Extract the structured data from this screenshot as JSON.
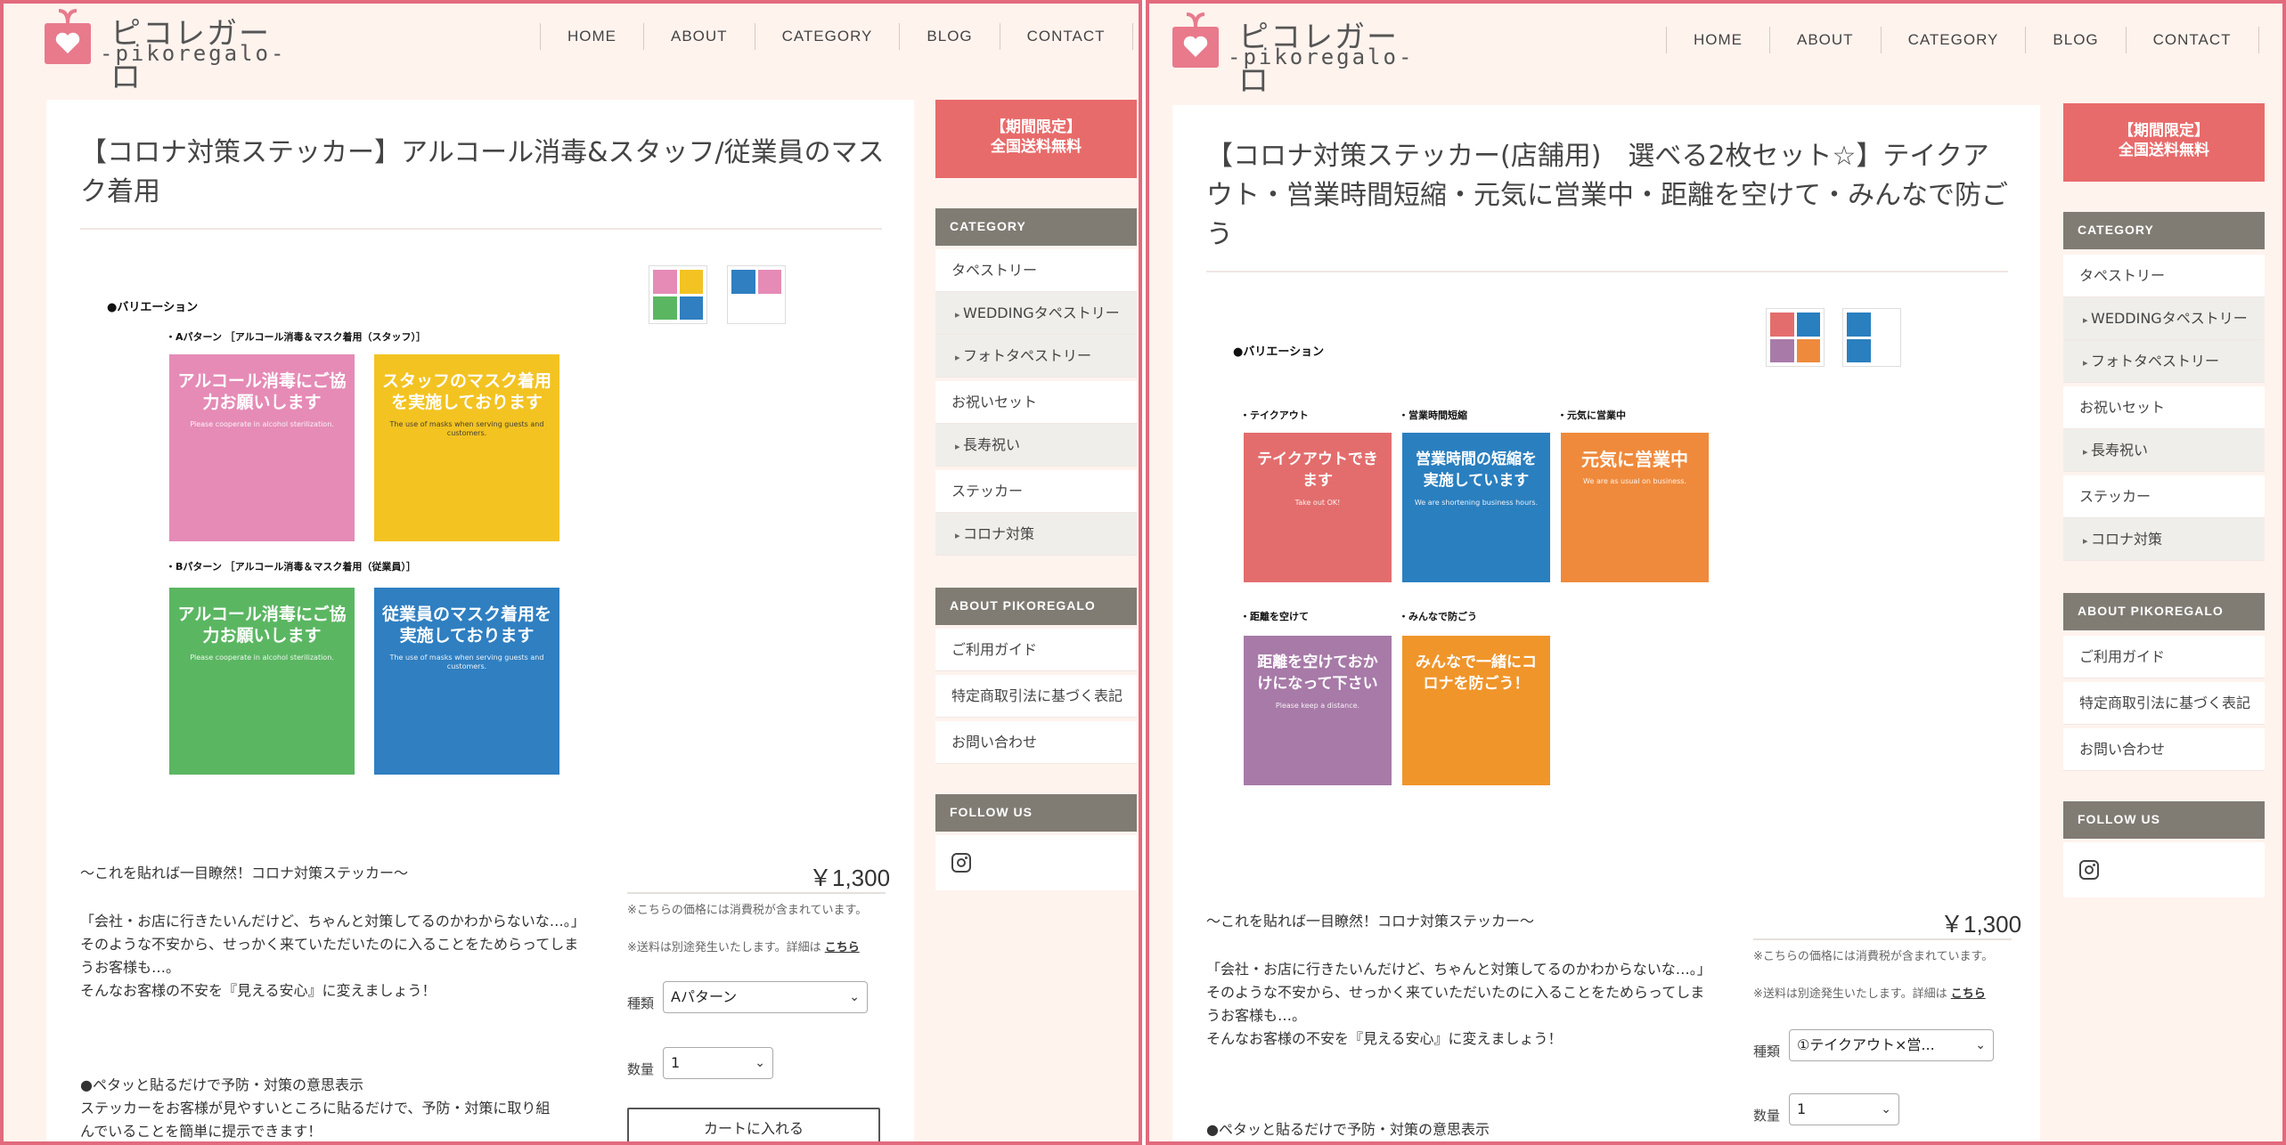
{
  "colors": {
    "page_bg": "#fff3ee",
    "frame": "#e26a7d",
    "banner": "#e86b6b",
    "side_head": "#807c74"
  },
  "header": {
    "logo_jp": "ピコレガーロ",
    "logo_en": "-pikoregalo-",
    "nav": [
      "HOME",
      "ABOUT",
      "CATEGORY",
      "BLOG",
      "CONTACT"
    ]
  },
  "sidebar": {
    "banner_line1": "【期間限定】",
    "banner_line2": "全国送料無料",
    "category_title": "CATEGORY",
    "categories": [
      "タペストリー",
      "WEDDINGタペストリー",
      "フォトタペストリー",
      "お祝いセット",
      "長寿祝い",
      "ステッカー",
      "コロナ対策"
    ],
    "about_title": "ABOUT PIKOREGALO",
    "about_items": [
      "ご利用ガイド",
      "特定商取引法に基づく表記",
      "お問い合わせ"
    ],
    "follow_title": "FOLLOW US",
    "instagram_icon": "instagram-icon"
  },
  "product1": {
    "title": "【コロナ対策ステッカー】アルコール消毒&スタッフ/従業員のマスク着用",
    "variation_head": "●バリエーション",
    "pattern_a": "・Aパターン ［アルコール消毒＆マスク着用（スタッフ）］",
    "pattern_b": "・Bパターン ［アルコール消毒＆マスク着用（従業員）］",
    "tiles": [
      {
        "title": "アルコール消毒にご協力お願いします",
        "en": "Please cooperate in alcohol sterilization.",
        "color": "#e58bb6"
      },
      {
        "title": "スタッフのマスク着用を実施しております",
        "en": "The use of masks when serving guests and customers.",
        "color": "#f3c322"
      },
      {
        "title": "アルコール消毒にご協力お願いします",
        "en": "Please cooperate in alcohol sterilization.",
        "color": "#5bb662"
      },
      {
        "title": "従業員のマスク着用を実施しております",
        "en": "The use of masks when serving guests and customers.",
        "color": "#2f7fc1"
      }
    ],
    "intro": "〜これを貼れば一目瞭然！コロナ対策ステッカー〜",
    "desc": [
      "「会社・お店に行きたいんだけど、ちゃんと対策してるのかわからないな…。」",
      "そのような不安から、せっかく来ていただいたのに入ることをためらってしまうお客様も…。",
      "そんなお客様の不安を『見える安心』に変えましょう！"
    ],
    "point_head": "●ペタッと貼るだけで予防・対策の意思表示",
    "point_body": [
      "ステッカーをお客様が見やすいところに貼るだけで、予防・対策に取り組",
      "んでいることを簡単に提示できます！"
    ],
    "price": "￥1,300",
    "tax_note": "※こちらの価格には消費税が含まれています。",
    "ship_note": "※送料は別途発生いたします。詳細は",
    "ship_link": "こちら",
    "type_label": "種類",
    "type_value": "Aパターン",
    "qty_label": "数量",
    "qty_value": "1",
    "cart_label": "カートに入れる"
  },
  "product2": {
    "title": "【コロナ対策ステッカー(店舗用)　選べる2枚セット☆】テイクアウト・営業時間短縮・元気に営業中・距離を空けて・みんなで防ごう",
    "variation_head": "●バリエーション",
    "labels": [
      "・テイクアウト",
      "・営業時間短縮",
      "・元気に営業中",
      "・距離を空けて",
      "・みんなで防ごう"
    ],
    "tiles": [
      {
        "title": "テイクアウトできます",
        "en": "Take out OK!",
        "color": "#e36d6d"
      },
      {
        "title": "営業時間の短縮を実施しています",
        "en": "We are shortening business hours.",
        "color": "#2a7fbf"
      },
      {
        "title": "元気に営業中",
        "en": "We are as usual on business.",
        "color": "#ef8a3c"
      },
      {
        "title": "距離を空けておかけになって下さい",
        "en": "Please keep a distance.",
        "color": "#a77aa8"
      },
      {
        "title": "みんなで一緒にコロナを防ごう！",
        "en": "",
        "color": "#f0952a"
      }
    ],
    "intro": "〜これを貼れば一目瞭然！コロナ対策ステッカー〜",
    "desc": [
      "「会社・お店に行きたいんだけど、ちゃんと対策してるのかわからないな…。」",
      "そのような不安から、せっかく来ていただいたのに入ることをためらってしまうお客様も…。",
      "そんなお客様の不安を『見える安心』に変えましょう！"
    ],
    "point_head": "●ペタッと貼るだけで予防・対策の意思表示",
    "price": "￥1,300",
    "tax_note": "※こちらの価格には消費税が含まれています。",
    "ship_note": "※送料は別途発生いたします。詳細は",
    "ship_link": "こちら",
    "type_label": "種類",
    "type_value": "①テイクアウト×営...",
    "qty_label": "数量",
    "qty_value": "1"
  }
}
